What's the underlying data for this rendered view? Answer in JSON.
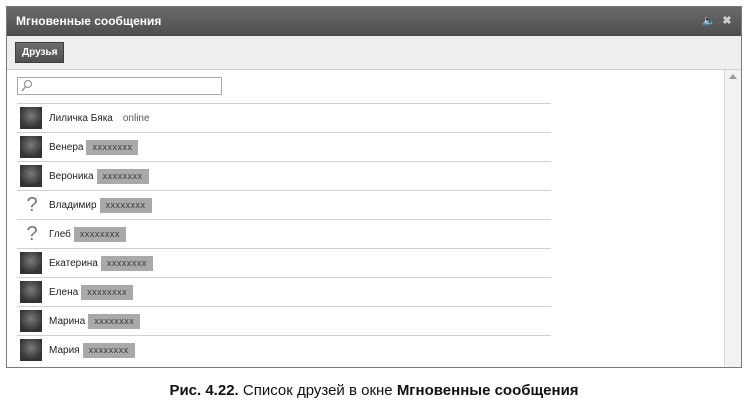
{
  "window": {
    "title": "Мгновенные сообщения",
    "tab_label": "Друзья",
    "search": {
      "placeholder": ""
    }
  },
  "friends": [
    {
      "name": "Лиличка Бяка",
      "status": "online",
      "masked": "",
      "avatar": "photo-icon"
    },
    {
      "name": "Венера",
      "status": "",
      "masked": "xxxxxxxx",
      "avatar": "photo-icon"
    },
    {
      "name": "Вероника",
      "status": "",
      "masked": "xxxxxxxx",
      "avatar": "photo-icon"
    },
    {
      "name": "Владимир",
      "status": "",
      "masked": "xxxxxxxx",
      "avatar": "question-mark-icon"
    },
    {
      "name": "Глеб",
      "status": "",
      "masked": "xxxxxxxx",
      "avatar": "question-mark-icon"
    },
    {
      "name": "Екатерина",
      "status": "",
      "masked": "xxxxxxxx",
      "avatar": "photo-icon"
    },
    {
      "name": "Елена",
      "status": "",
      "masked": "xxxxxxxx",
      "avatar": "photo-icon"
    },
    {
      "name": "Марина",
      "status": "",
      "masked": "xxxxxxxx",
      "avatar": "photo-icon"
    },
    {
      "name": "Мария",
      "status": "",
      "masked": "xxxxxxxx",
      "avatar": "photo-icon"
    }
  ],
  "caption": {
    "prefix": "Рис. 4.22.",
    "text": " Список друзей в окне ",
    "emphasis": "Мгновенные сообщения"
  }
}
